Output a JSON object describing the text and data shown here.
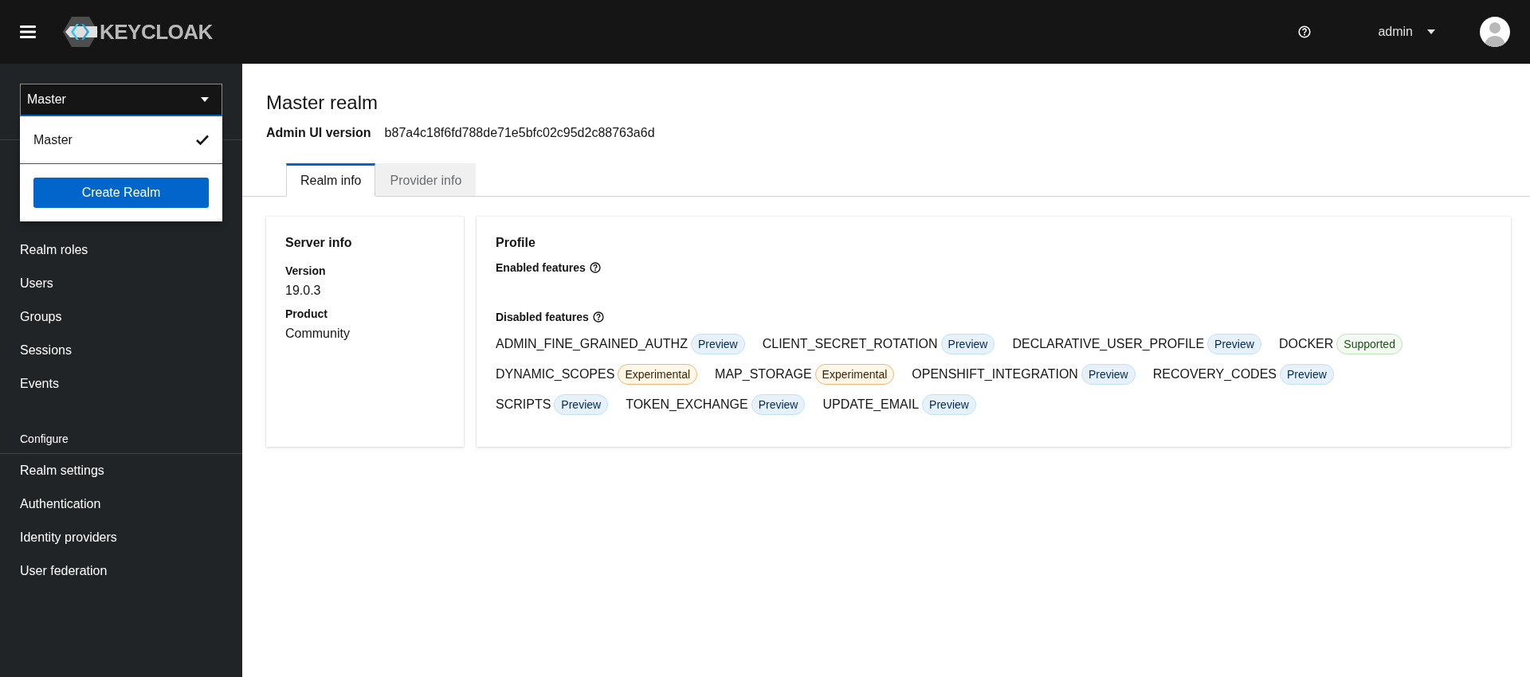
{
  "header": {
    "brand": "KEYCLOAK",
    "user": "admin"
  },
  "realm_selector": {
    "value": "Master",
    "menu_open": true,
    "options": [
      {
        "label": "Master",
        "selected": true
      }
    ],
    "create_button": "Create Realm"
  },
  "sidebar": {
    "items": [
      {
        "label": "Realm roles"
      },
      {
        "label": "Users"
      },
      {
        "label": "Groups"
      },
      {
        "label": "Sessions"
      },
      {
        "label": "Events"
      }
    ],
    "sections": [
      {
        "title": "Configure",
        "items": [
          {
            "label": "Realm settings"
          },
          {
            "label": "Authentication"
          },
          {
            "label": "Identity providers"
          },
          {
            "label": "User federation"
          }
        ]
      }
    ]
  },
  "page": {
    "title": "Master realm",
    "version_label": "Admin UI version",
    "version_value": "b87a4c18f6fd788de71e5bfc02c95d2c88763a6d"
  },
  "tabs": [
    {
      "label": "Realm info",
      "selected": true
    },
    {
      "label": "Provider info",
      "selected": false
    }
  ],
  "server_info": {
    "title": "Server info",
    "fields": [
      {
        "label": "Version",
        "value": "19.0.3"
      },
      {
        "label": "Product",
        "value": "Community"
      }
    ]
  },
  "profile": {
    "title": "Profile",
    "enabled_label": "Enabled features",
    "disabled_label": "Disabled features",
    "disabled_features": [
      {
        "name": "ADMIN_FINE_GRAINED_AUTHZ",
        "tag": "Preview",
        "kind": "preview"
      },
      {
        "name": "CLIENT_SECRET_ROTATION",
        "tag": "Preview",
        "kind": "preview"
      },
      {
        "name": "DECLARATIVE_USER_PROFILE",
        "tag": "Preview",
        "kind": "preview"
      },
      {
        "name": "DOCKER",
        "tag": "Supported",
        "kind": "supported"
      },
      {
        "name": "DYNAMIC_SCOPES",
        "tag": "Experimental",
        "kind": "experimental"
      },
      {
        "name": "MAP_STORAGE",
        "tag": "Experimental",
        "kind": "experimental"
      },
      {
        "name": "OPENSHIFT_INTEGRATION",
        "tag": "Preview",
        "kind": "preview"
      },
      {
        "name": "RECOVERY_CODES",
        "tag": "Preview",
        "kind": "preview"
      },
      {
        "name": "SCRIPTS",
        "tag": "Preview",
        "kind": "preview"
      },
      {
        "name": "TOKEN_EXCHANGE",
        "tag": "Preview",
        "kind": "preview"
      },
      {
        "name": "UPDATE_EMAIL",
        "tag": "Preview",
        "kind": "preview"
      }
    ]
  }
}
